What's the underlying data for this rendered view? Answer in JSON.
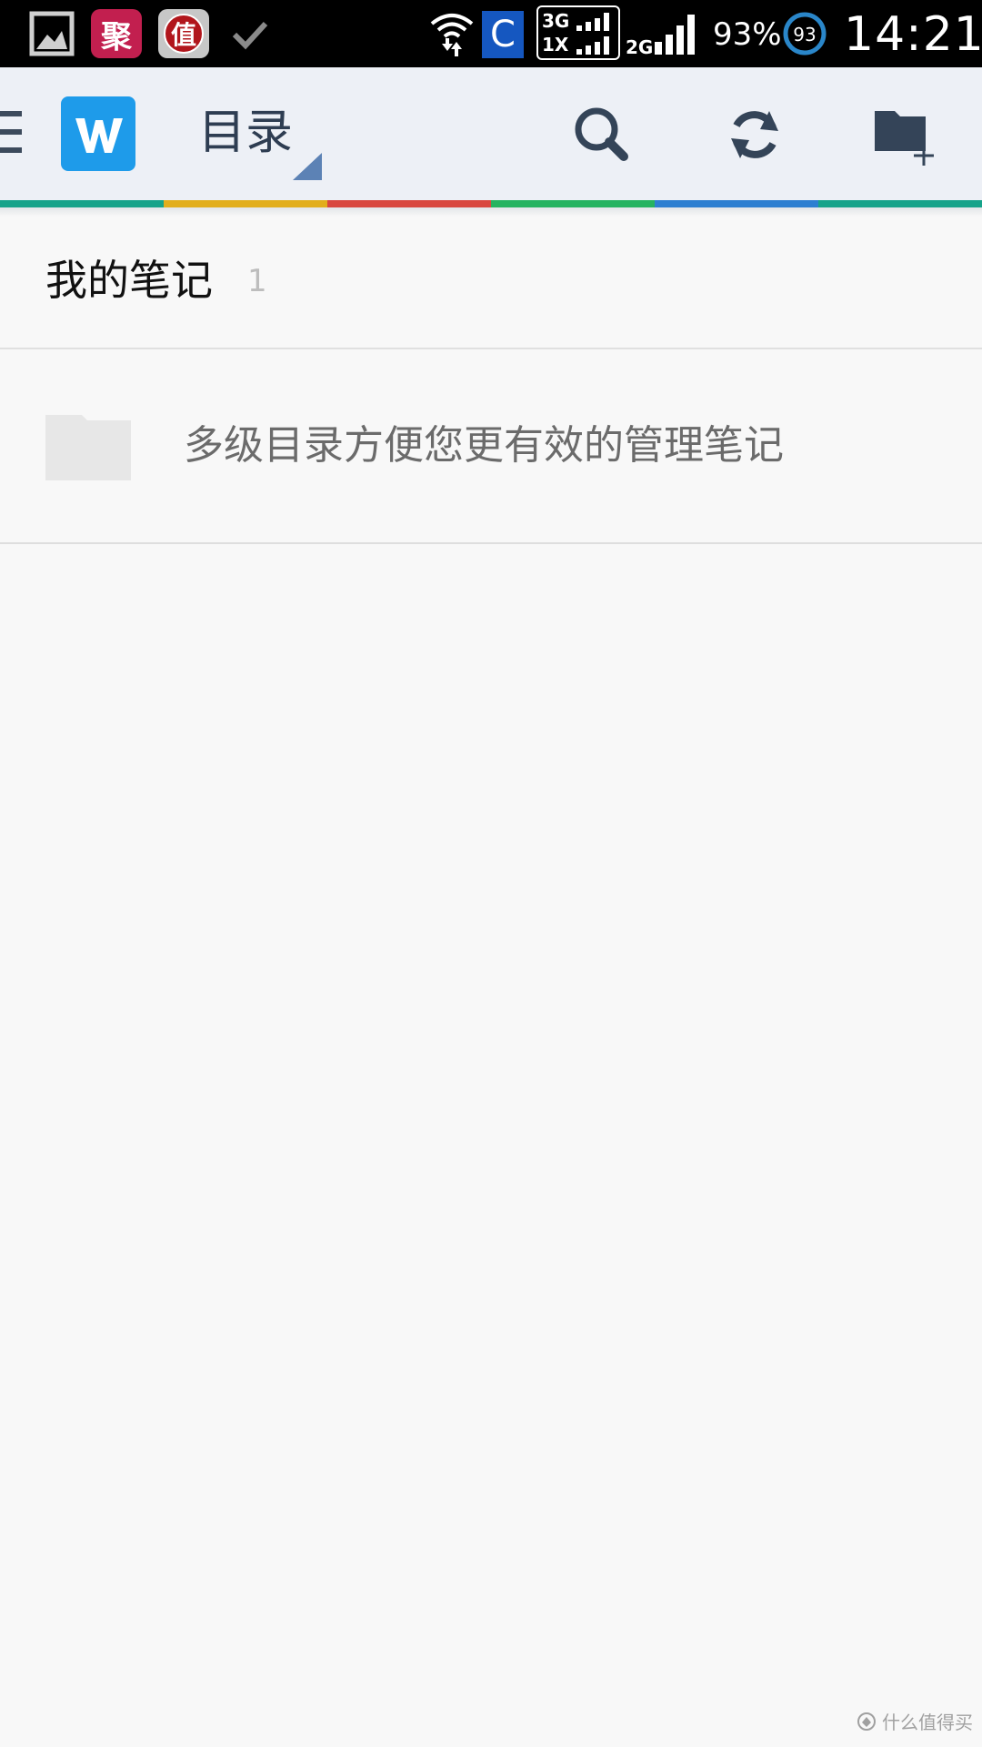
{
  "status_bar": {
    "notif_ju": "聚",
    "notif_zhi": "值",
    "carrier_c": "C",
    "net_3g": "3G",
    "net_1x": "1X",
    "net_2g": "2G",
    "battery_pct": "93%",
    "battery_level": "93",
    "time": "14:21",
    "icons": [
      "gallery-icon",
      "ju-app-icon",
      "zhi-app-icon",
      "check-icon",
      "wifi-icon",
      "signal-icon",
      "battery-icon"
    ]
  },
  "header": {
    "title": "目录",
    "actions": [
      "search-icon",
      "sync-icon",
      "new-folder-icon"
    ],
    "logo": "wiz-logo"
  },
  "stripe_colors": [
    "#16a38a",
    "#e2ae1c",
    "#d9473f",
    "#25b360",
    "#2d7fd1",
    "#16a38a"
  ],
  "colors": {
    "header_bg": "#edf0f6",
    "header_text": "#2e3d52",
    "logo_bg": "#1e9bea",
    "content_bg": "#f8f8f8"
  },
  "notebook": {
    "name": "我的笔记",
    "count": "1"
  },
  "hint": {
    "text": "多级目录方便您更有效的管理笔记"
  },
  "watermark": {
    "text": "什么值得买"
  }
}
